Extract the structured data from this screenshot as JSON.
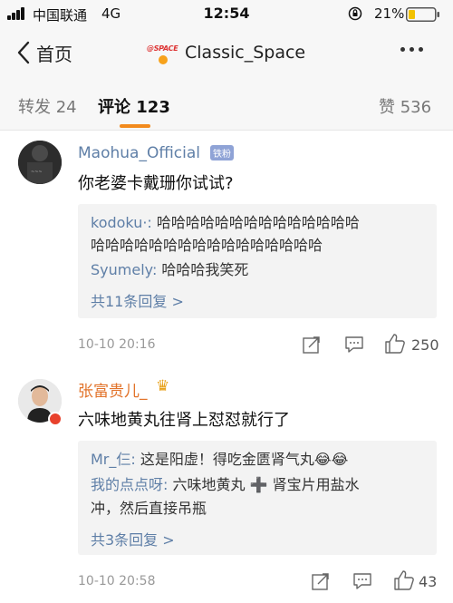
{
  "status_bar": {
    "carrier": "中国联通",
    "network": "4G",
    "time": "12:54",
    "battery": "21%"
  },
  "nav": {
    "back_label": "首页",
    "title": "Classic_Space",
    "avatar_text": "@SPACE"
  },
  "tabs": [
    {
      "label": "转发 24"
    },
    {
      "label": "评论 123"
    },
    {
      "label": "赞 536"
    }
  ],
  "comments": [
    {
      "user": "Maohua_Official",
      "badge": "铁粉",
      "text": "你老婆卡戴珊你试试?",
      "replies": [
        {
          "user": "kodoku·:",
          "text": " 哈哈哈哈哈哈哈哈哈哈哈哈哈哈"
        },
        {
          "user": "",
          "text": "哈哈哈哈哈哈哈哈哈哈哈哈哈哈哈哈"
        },
        {
          "user": "Syumely:",
          "text": " 哈哈哈我笑死"
        }
      ],
      "more_replies": "共11条回复 >",
      "time": "10-10 20:16",
      "likes": "250"
    },
    {
      "user": "张富贵儿_",
      "text": "六味地黄丸往肾上怼怼就行了",
      "replies": [
        {
          "user": "Mr_仨:",
          "text": " 这是阳虚！得吃金匮肾气丸😂😂"
        },
        {
          "user": "我的点点呀:",
          "text": " 六味地黄丸 ➕ 肾宝片用盐水"
        },
        {
          "user": "",
          "text": "冲，然后直接吊瓶"
        }
      ],
      "more_replies": "共3条回复 >",
      "time": "10-10 20:58",
      "likes": "43"
    }
  ],
  "colors": {
    "accent": "#f28a1c",
    "link": "#5f7fa7",
    "vip_name": "#e2732a"
  }
}
